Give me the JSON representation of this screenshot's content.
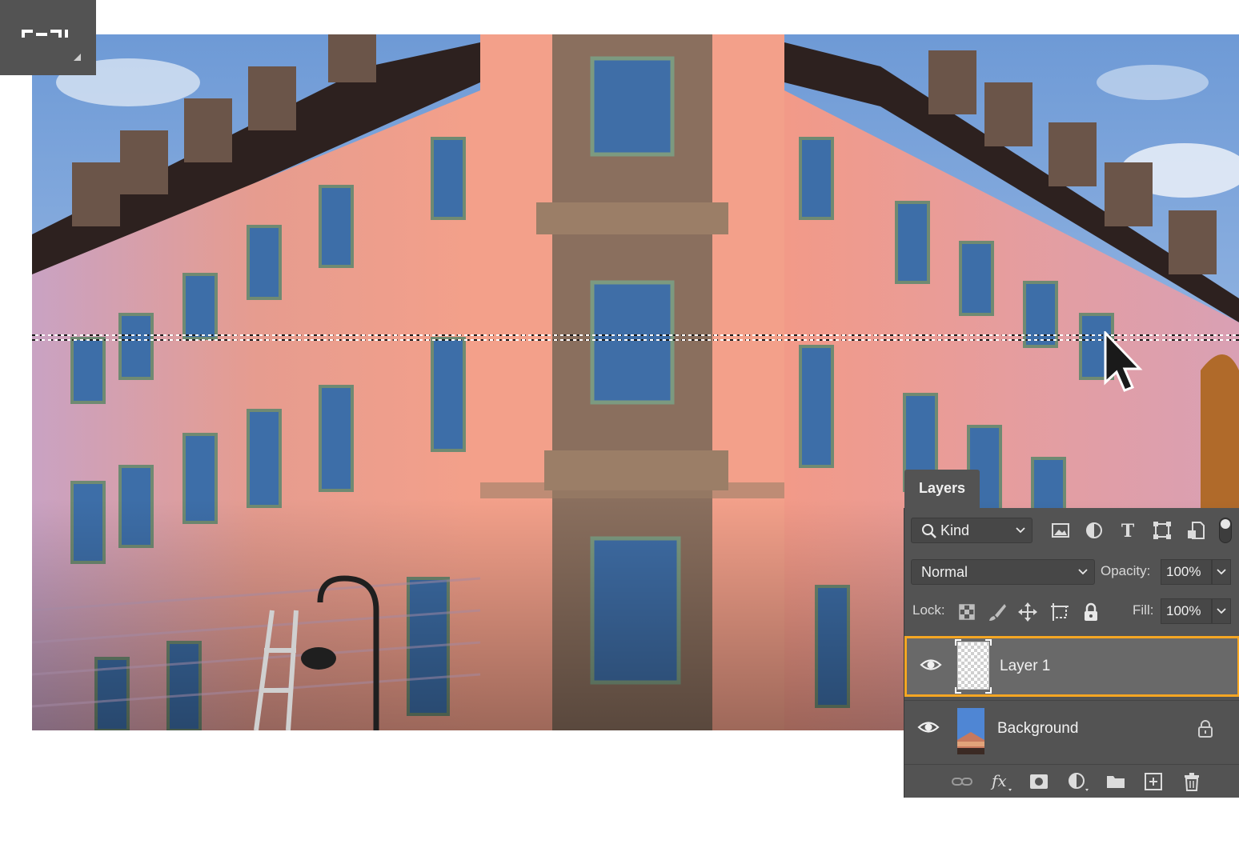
{
  "panel": {
    "tab_label": "Layers",
    "filter": {
      "kind_label": "Kind"
    },
    "blend": {
      "mode": "Normal",
      "opacity_label": "Opacity:",
      "opacity_value": "100%"
    },
    "lock": {
      "label": "Lock:",
      "fill_label": "Fill:",
      "fill_value": "100%"
    },
    "layers": [
      {
        "name": "Layer 1",
        "selected": true,
        "visible": true,
        "locked": false
      },
      {
        "name": "Background",
        "selected": false,
        "visible": true,
        "locked": true
      }
    ]
  },
  "colors": {
    "panel_bg": "#535353",
    "selected_row": "#696969",
    "selection_highlight": "#f5a623"
  },
  "icons": [
    "single-row-marquee-icon",
    "search-icon",
    "chevron-down-icon",
    "image-filter-icon",
    "adjustment-filter-icon",
    "type-filter-icon",
    "shape-filter-icon",
    "smart-object-filter-icon",
    "lock-transparent-pixels-icon",
    "lock-image-pixels-icon",
    "lock-position-icon",
    "lock-artboard-icon",
    "lock-all-icon",
    "eye-icon",
    "link-layers-icon",
    "fx-icon",
    "layer-mask-icon",
    "adjustment-layer-icon",
    "folder-icon",
    "new-layer-icon",
    "trash-icon"
  ]
}
